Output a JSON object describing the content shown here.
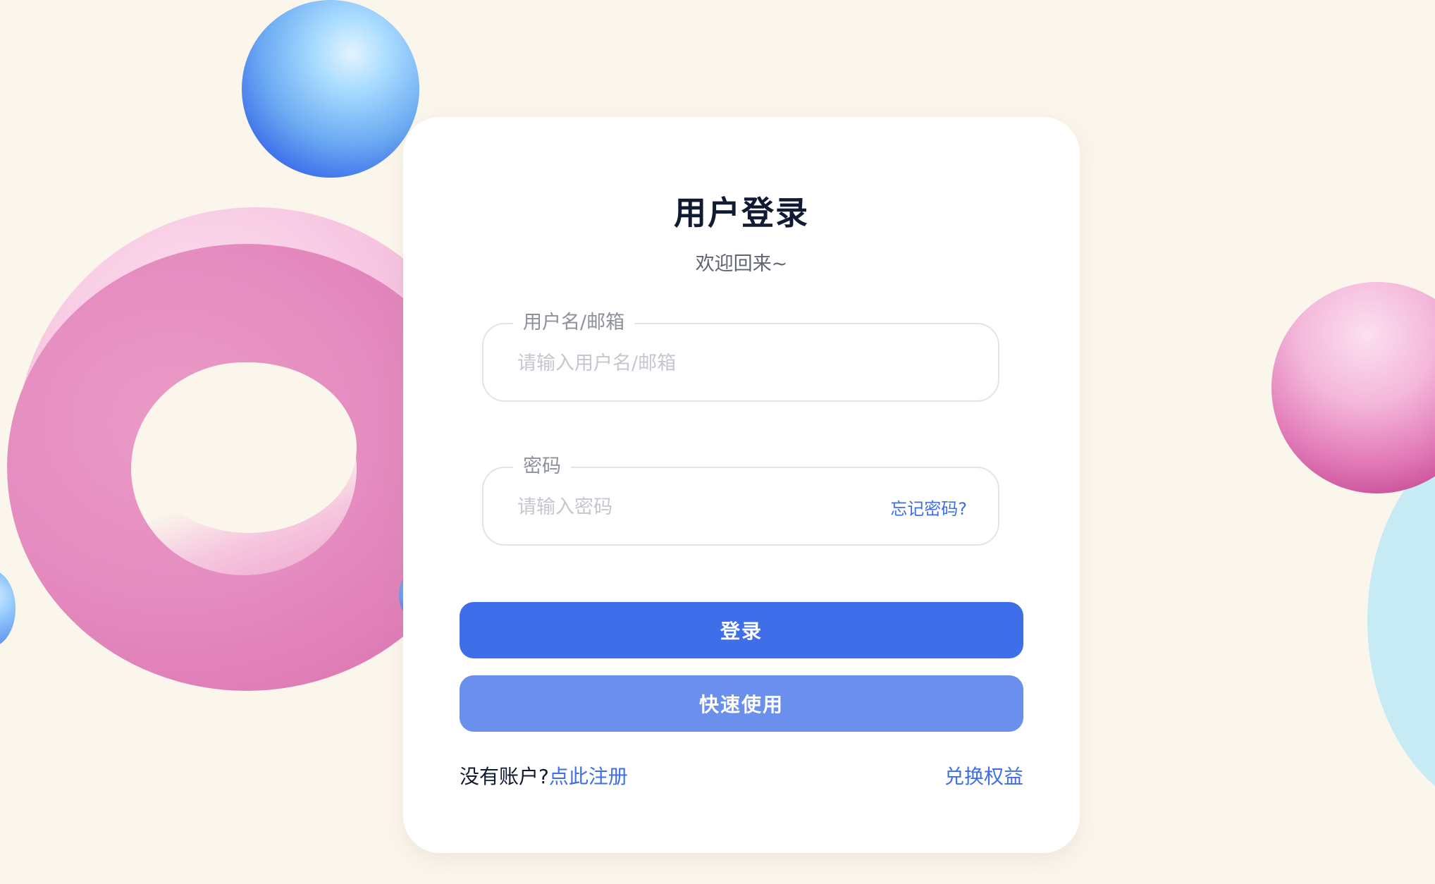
{
  "login": {
    "title": "用户登录",
    "subtitle": "欢迎回来~",
    "username": {
      "label": "用户名/邮箱",
      "placeholder": "请输入用户名/邮箱",
      "value": ""
    },
    "password": {
      "label": "密码",
      "placeholder": "请输入密码",
      "value": "",
      "forgot_label": "忘记密码?"
    },
    "login_button": "登录",
    "quick_button": "快速使用",
    "no_account_text": "没有账户?",
    "register_link": "点此注册",
    "redeem_link": "兑换权益"
  },
  "colors": {
    "accent": "#3f6fe8",
    "accent_light": "#6a8fec",
    "background": "#fbf6ec",
    "title": "#111a33"
  }
}
